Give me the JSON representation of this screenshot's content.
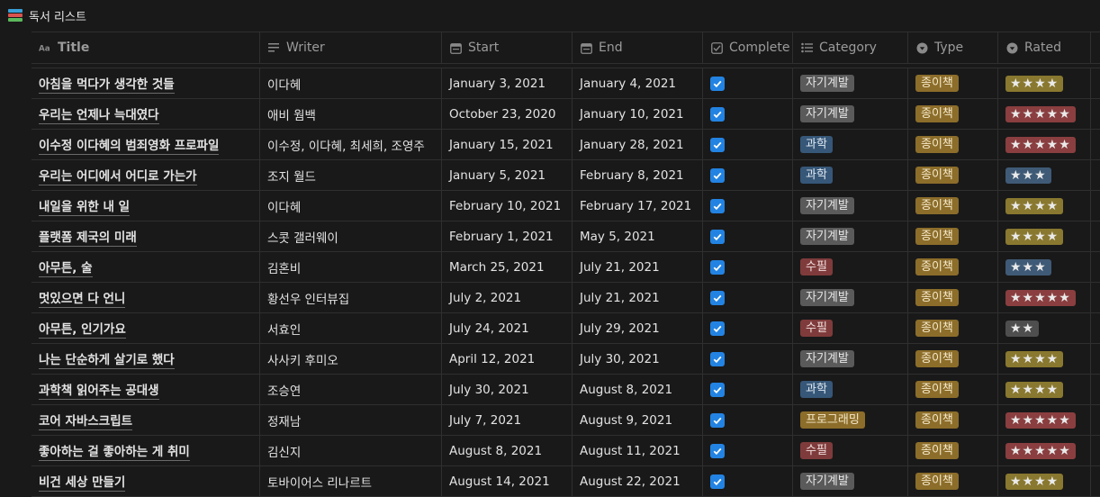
{
  "page": {
    "title": "독서 리스트",
    "icon": "books-icon"
  },
  "columns": [
    {
      "key": "title",
      "label": "Title",
      "icon": "text-type-icon"
    },
    {
      "key": "writer",
      "label": "Writer",
      "icon": "text-lines-icon"
    },
    {
      "key": "start",
      "label": "Start",
      "icon": "calendar-icon"
    },
    {
      "key": "end",
      "label": "End",
      "icon": "calendar-icon"
    },
    {
      "key": "complete",
      "label": "Complete",
      "icon": "checkbox-icon"
    },
    {
      "key": "category",
      "label": "Category",
      "icon": "list-icon"
    },
    {
      "key": "type",
      "label": "Type",
      "icon": "select-icon"
    },
    {
      "key": "rated",
      "label": "Rated",
      "icon": "select-icon"
    }
  ],
  "colors": {
    "background": "#191919",
    "checkbox": "#2383e2",
    "tag_gray": "#5a5a5a",
    "tag_blue": "#365778",
    "tag_red": "#7f3b3b",
    "tag_yellow": "#8c6d2a"
  },
  "rows": [
    {
      "title": "아침을 먹다가 생각한 것들",
      "writer": "이다혜",
      "start": "January 3, 2021",
      "end": "January 4, 2021",
      "complete": true,
      "category": "자기계발",
      "category_color": "gray",
      "type": "종이책",
      "rated": "★★★★",
      "rated_stars": 4
    },
    {
      "title": "우리는 언제나 늑대였다",
      "writer": "애비 웜백",
      "start": "October 23, 2020",
      "end": "January 10, 2021",
      "complete": true,
      "category": "자기계발",
      "category_color": "gray",
      "type": "종이책",
      "rated": "★★★★★",
      "rated_stars": 5
    },
    {
      "title": "이수정 이다혜의 범죄영화 프로파일",
      "writer": "이수정, 이다혜, 최세희, 조영주",
      "start": "January 15, 2021",
      "end": "January 28, 2021",
      "complete": true,
      "category": "과학",
      "category_color": "blue",
      "type": "종이책",
      "rated": "★★★★★",
      "rated_stars": 5
    },
    {
      "title": "우리는 어디에서 어디로 가는가",
      "writer": "조지 월드",
      "start": "January 5, 2021",
      "end": "February 8, 2021",
      "complete": true,
      "category": "과학",
      "category_color": "blue",
      "type": "종이책",
      "rated": "★★★",
      "rated_stars": 3
    },
    {
      "title": "내일을 위한 내 일",
      "writer": "이다혜",
      "start": "February 10, 2021",
      "end": "February 17, 2021",
      "complete": true,
      "category": "자기계발",
      "category_color": "gray",
      "type": "종이책",
      "rated": "★★★★",
      "rated_stars": 4
    },
    {
      "title": "플랫폼 제국의 미래",
      "writer": "스콧 갤러웨이",
      "start": "February 1, 2021",
      "end": "May 5, 2021",
      "complete": true,
      "category": "자기계발",
      "category_color": "gray",
      "type": "종이책",
      "rated": "★★★★",
      "rated_stars": 4
    },
    {
      "title": "아무튼, 술",
      "writer": "김혼비",
      "start": "March 25, 2021",
      "end": "July 21, 2021",
      "complete": true,
      "category": "수필",
      "category_color": "red",
      "type": "종이책",
      "rated": "★★★",
      "rated_stars": 3
    },
    {
      "title": "멋있으면 다 언니",
      "writer": "황선우 인터뷰집",
      "start": "July 2, 2021",
      "end": "July 21, 2021",
      "complete": true,
      "category": "자기계발",
      "category_color": "gray",
      "type": "종이책",
      "rated": "★★★★★",
      "rated_stars": 5
    },
    {
      "title": "아무튼, 인기가요",
      "writer": "서효인",
      "start": "July 24, 2021",
      "end": "July 29, 2021",
      "complete": true,
      "category": "수필",
      "category_color": "red",
      "type": "종이책",
      "rated": "★★",
      "rated_stars": 2
    },
    {
      "title": "나는 단순하게 살기로 했다",
      "writer": "사사키 후미오",
      "start": "April 12, 2021",
      "end": "July 30, 2021",
      "complete": true,
      "category": "자기계발",
      "category_color": "gray",
      "type": "종이책",
      "rated": "★★★★",
      "rated_stars": 4
    },
    {
      "title": "과학책 읽어주는 공대생",
      "writer": "조승연",
      "start": "July 30, 2021",
      "end": "August 8, 2021",
      "complete": true,
      "category": "과학",
      "category_color": "blue",
      "type": "종이책",
      "rated": "★★★★",
      "rated_stars": 4
    },
    {
      "title": "코어 자바스크립트",
      "writer": "정재남",
      "start": "July 7, 2021",
      "end": "August 9, 2021",
      "complete": true,
      "category": "프로그래밍",
      "category_color": "yellow",
      "type": "종이책",
      "rated": "★★★★★",
      "rated_stars": 5
    },
    {
      "title": "좋아하는 걸 좋아하는 게 취미",
      "writer": "김신지",
      "start": "August 8, 2021",
      "end": "August 11, 2021",
      "complete": true,
      "category": "수필",
      "category_color": "red",
      "type": "종이책",
      "rated": "★★★★★",
      "rated_stars": 5
    },
    {
      "title": "비건 세상 만들기",
      "writer": "토바이어스 리나르트",
      "start": "August 14, 2021",
      "end": "August 22, 2021",
      "complete": true,
      "category": "자기계발",
      "category_color": "gray",
      "type": "종이책",
      "rated": "★★★★",
      "rated_stars": 4
    }
  ]
}
